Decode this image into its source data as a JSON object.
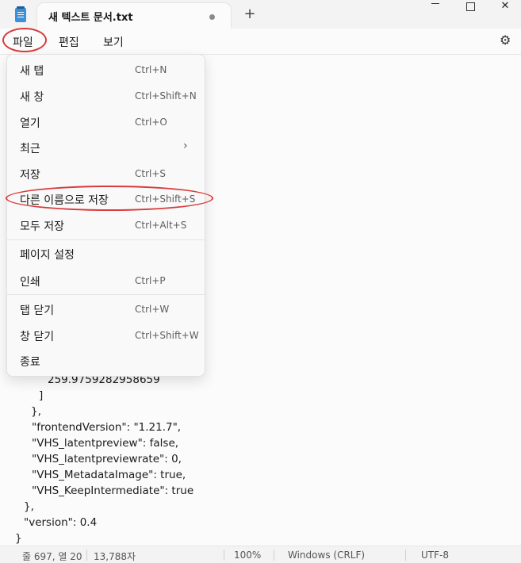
{
  "window": {
    "tab_title": "새 텍스트 문서.txt",
    "new_tab_symbol": "+",
    "minimize_icon": "minimize-icon",
    "maximize_icon": "maximize-icon",
    "close_symbol": "✕"
  },
  "menubar": {
    "file": "파일",
    "edit": "편집",
    "view": "보기",
    "settings_icon": "gear-icon"
  },
  "file_menu": {
    "items": [
      {
        "label": "새 탭",
        "shortcut": "Ctrl+N"
      },
      {
        "label": "새 창",
        "shortcut": "Ctrl+Shift+N"
      },
      {
        "label": "열기",
        "shortcut": "Ctrl+O"
      },
      {
        "label": "최근",
        "shortcut": "",
        "submenu_arrow": "›"
      },
      {
        "label": "저장",
        "shortcut": "Ctrl+S"
      },
      {
        "label": "다른 이름으로 저장",
        "shortcut": "Ctrl+Shift+S"
      },
      {
        "label": "모두 저장",
        "shortcut": "Ctrl+Alt+S"
      },
      {
        "label": "페이지 설정",
        "shortcut": ""
      },
      {
        "label": "인쇄",
        "shortcut": "Ctrl+P"
      },
      {
        "label": "탭 닫기",
        "shortcut": "Ctrl+W"
      },
      {
        "label": "창 닫기",
        "shortcut": "Ctrl+Shift+W"
      },
      {
        "label": "종료",
        "shortcut": ""
      }
    ]
  },
  "editor": {
    "lines": [
      "259.9759282958659",
      "]",
      "},",
      "\"frontendVersion\": \"1.21.7\",",
      "\"VHS_latentpreview\": false,",
      "\"VHS_latentpreviewrate\": 0,",
      "\"VHS_MetadataImage\": true,",
      "\"VHS_KeepIntermediate\": true",
      "},",
      "\"version\": 0.4",
      "}"
    ]
  },
  "statusbar": {
    "position": "줄 697, 열 20",
    "char_count": "13,788자",
    "zoom": "100%",
    "line_ending": "Windows (CRLF)",
    "encoding": "UTF-8"
  },
  "colors": {
    "highlight_annotation": "#d93a3a",
    "app_icon": "#3d8fd6"
  }
}
